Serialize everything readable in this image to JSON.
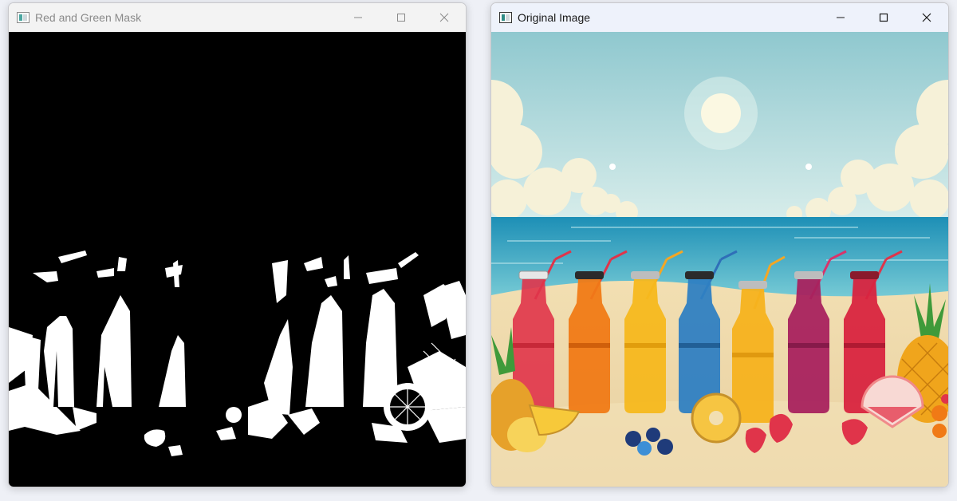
{
  "windows": [
    {
      "title": "Red and Green Mask",
      "active": false,
      "icon": "opencv-window-icon",
      "controls": [
        "minimize-icon",
        "maximize-icon",
        "close-icon"
      ]
    },
    {
      "title": "Original Image",
      "active": true,
      "icon": "opencv-window-icon",
      "controls": [
        "minimize-icon",
        "maximize-icon",
        "close-icon"
      ]
    }
  ],
  "colors": {
    "mask_background": "#000000",
    "mask_foreground": "#ffffff",
    "sky": "#a9d6d8",
    "sea": "#3aa9c7",
    "sand": "#efd9a8",
    "juices": [
      "#e0344a",
      "#f07a16",
      "#f5b81d",
      "#2f7fc2",
      "#f5b21d",
      "#a8225e",
      "#d8243f"
    ],
    "straws": [
      "#e0344a",
      "#f07a16",
      "#f5a623",
      "#2f6fb8",
      "#f5a623",
      "#d8336b",
      "#e0344a"
    ]
  }
}
